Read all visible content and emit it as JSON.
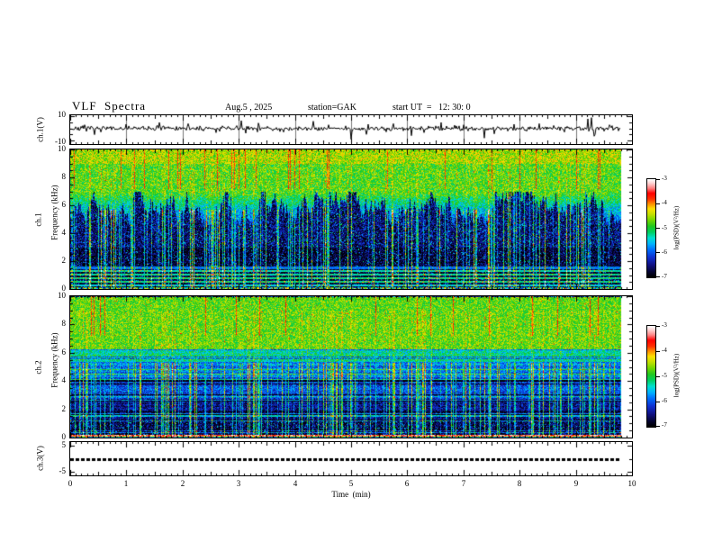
{
  "header": {
    "title": "VLF  Spectra",
    "date": "Aug.5 , 2025",
    "station": "station=GAK",
    "start_ut": "start UT  =   12: 30: 0"
  },
  "xaxis": {
    "label": "Time  (min)",
    "ticks": [
      "0",
      "1",
      "2",
      "3",
      "4",
      "5",
      "6",
      "7",
      "8",
      "9",
      "10"
    ]
  },
  "panels": {
    "wave1": {
      "ylabel": "ch.1(V)",
      "ytick_top": "10",
      "ytick_bottom": "-10"
    },
    "spec1": {
      "ylabel_ch": "ch.1",
      "ylabel_freq": "Frequency (kHz)",
      "yticks": [
        "10",
        "8",
        "6",
        "4",
        "2",
        "0"
      ]
    },
    "spec2": {
      "ylabel_ch": "ch.2",
      "ylabel_freq": "Frequency (kHz)",
      "yticks": [
        "10",
        "8",
        "6",
        "4",
        "2",
        "0"
      ]
    },
    "wave3": {
      "ylabel": "ch.3(V)",
      "ytick_top": "5",
      "ytick_bottom": "-5"
    }
  },
  "colorbar": {
    "label": "log(PSD)(V²/Hz)",
    "ticks": [
      "-3",
      "-4",
      "-5",
      "-6",
      "-7"
    ]
  },
  "chart_data": {
    "type": "multi-panel",
    "title": "VLF Spectra, Aug.5 2025, station=GAK, start UT = 12:30:0",
    "x_range_min": [
      0,
      10
    ],
    "data_end_min": 9.8,
    "colormap": {
      "zlim": [
        -7,
        -3
      ],
      "stops": [
        [
          0.0,
          "#000000"
        ],
        [
          0.05,
          "#050530"
        ],
        [
          0.12,
          "#101080"
        ],
        [
          0.2,
          "#1030d0"
        ],
        [
          0.28,
          "#0070ff"
        ],
        [
          0.34,
          "#00b4ff"
        ],
        [
          0.4,
          "#00e0d0"
        ],
        [
          0.46,
          "#00d060"
        ],
        [
          0.52,
          "#20c820"
        ],
        [
          0.58,
          "#70d800"
        ],
        [
          0.64,
          "#c0e000"
        ],
        [
          0.7,
          "#ffe000"
        ],
        [
          0.75,
          "#ff9000"
        ],
        [
          0.8,
          "#ff3000"
        ],
        [
          0.86,
          "#ff0000"
        ],
        [
          0.91,
          "#ff8080"
        ],
        [
          0.96,
          "#ffd0d0"
        ],
        [
          1.0,
          "#ffffff"
        ]
      ]
    },
    "panels": [
      {
        "type": "line",
        "name": "ch1_waveform",
        "ylabel": "ch.1(V)",
        "ylim": [
          -13,
          11
        ],
        "noise_amp": 0.85,
        "seed": 7,
        "spikes": [
          [
            0.25,
            3
          ],
          [
            0.55,
            -3
          ],
          [
            1.0,
            3.5
          ],
          [
            1.58,
            5
          ],
          [
            2.1,
            4
          ],
          [
            2.6,
            -3.5
          ],
          [
            3.05,
            6.5
          ],
          [
            3.12,
            -4
          ],
          [
            3.35,
            4.5
          ],
          [
            3.8,
            -3
          ],
          [
            4.33,
            6
          ],
          [
            4.6,
            3
          ],
          [
            5.0,
            -9
          ],
          [
            5.3,
            3.5
          ],
          [
            5.75,
            4
          ],
          [
            6.08,
            -6
          ],
          [
            6.3,
            -3.5
          ],
          [
            6.6,
            5
          ],
          [
            7.0,
            3
          ],
          [
            7.37,
            -8
          ],
          [
            7.55,
            -4.5
          ],
          [
            7.9,
            3.5
          ],
          [
            8.35,
            4
          ],
          [
            8.8,
            -3
          ],
          [
            9.22,
            8
          ],
          [
            9.28,
            9
          ],
          [
            9.35,
            -5
          ],
          [
            9.6,
            3
          ]
        ]
      },
      {
        "type": "heatmap",
        "name": "ch1_spectrogram",
        "flim": [
          0,
          10
        ],
        "zlim": [
          -7,
          -3
        ],
        "seed": 101,
        "green_top": -4.5,
        "green": -4.8,
        "boundary": {
          "center": 5.7,
          "min": 4.6,
          "max": 7.3,
          "jitter": 1.5,
          "green_until": 7.0
        },
        "dark_high": -6.6,
        "dark_low": -6.85,
        "dark_split": 3.0,
        "lines": [
          [
            0.55,
            -5.25
          ],
          [
            0.8,
            -5.25
          ],
          [
            1.05,
            -5.3
          ],
          [
            1.3,
            -5.35
          ],
          [
            1.55,
            -5.9
          ],
          [
            0.3,
            -5.5
          ]
        ],
        "noise": 0.5,
        "streak_p": 0.2,
        "streak_max": 1.8,
        "red_streak_p": 0.04,
        "bottom_speckle_f": 0.18
      },
      {
        "type": "heatmap",
        "name": "ch2_spectrogram",
        "flim": [
          0,
          10
        ],
        "zlim": [
          -7,
          -3
        ],
        "seed": 202,
        "bands": [
          [
            6.3,
            10,
            -4.75
          ],
          [
            5.3,
            6.3,
            -5.3
          ],
          [
            4.3,
            5.3,
            -5.85
          ],
          [
            2.8,
            4.3,
            -6.15
          ],
          [
            1.3,
            2.8,
            -6.45
          ],
          [
            0.22,
            1.3,
            -6.75
          ],
          [
            0.1,
            0.22,
            -4.1
          ],
          [
            0,
            0.1,
            -6.2
          ]
        ],
        "stripe_max_f": 6.3,
        "noise": 0.45,
        "streak_p": 0.24,
        "streak_max": 1.6,
        "red_streak_p": 0.03,
        "bottom_speckle_f": 0.06
      },
      {
        "type": "line",
        "name": "ch3_waveform",
        "ylabel": "ch.3(V)",
        "ylim": [
          -6.5,
          6.5
        ],
        "constant_value": 0,
        "style": "thick-dashed"
      }
    ]
  }
}
